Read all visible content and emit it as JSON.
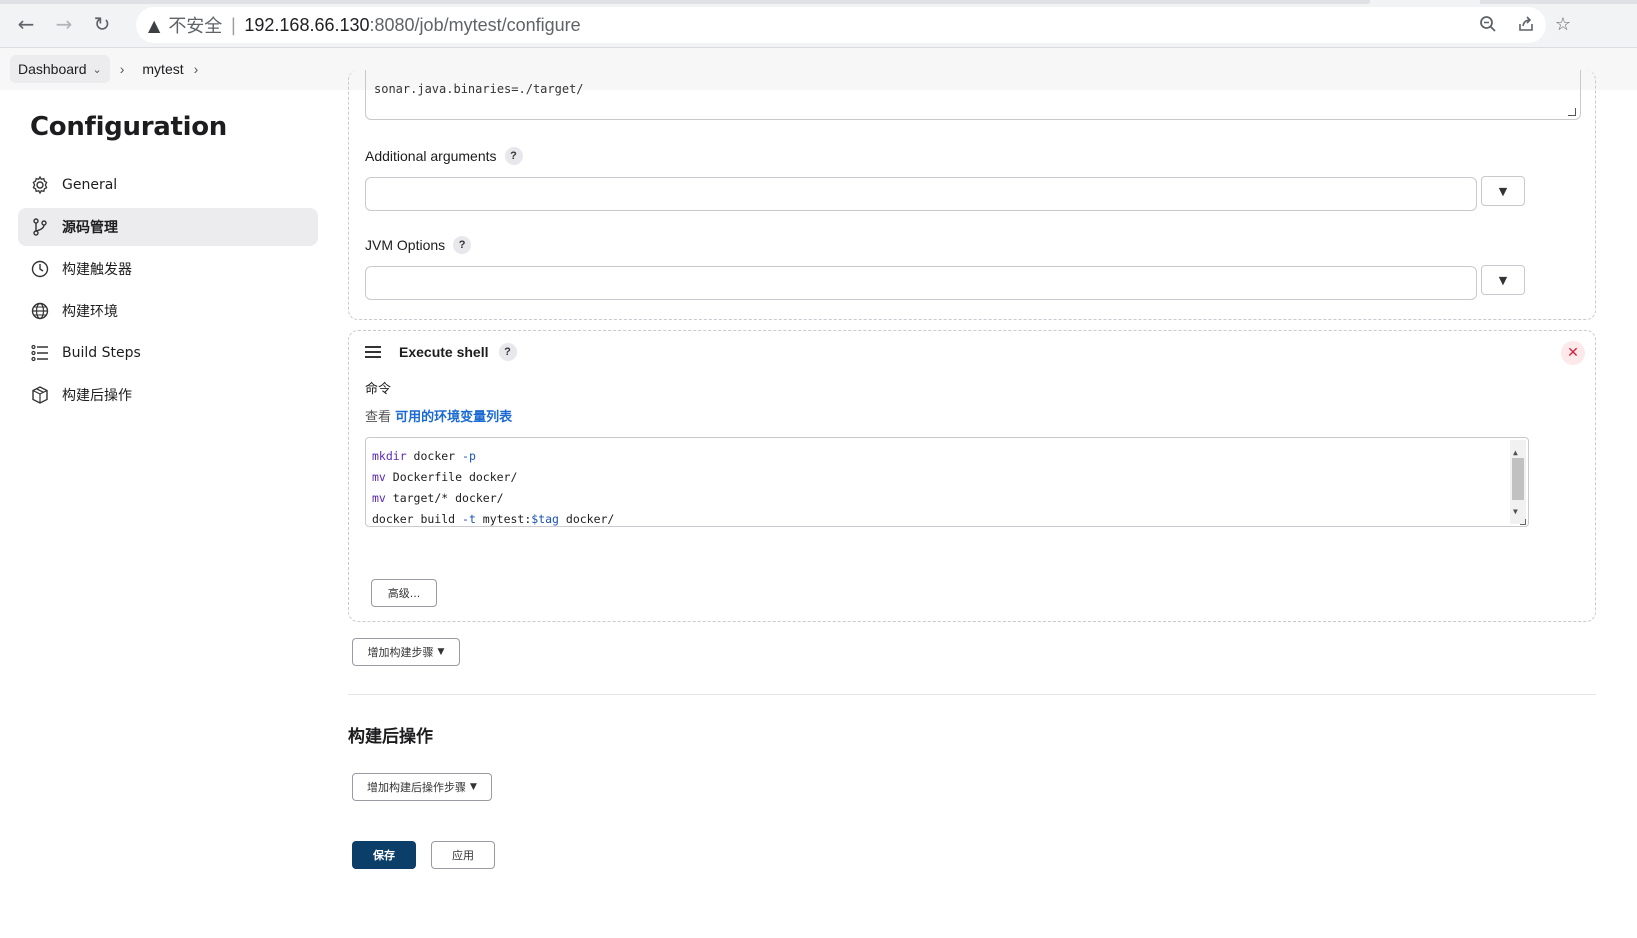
{
  "browser": {
    "insecure_label": "不安全",
    "separator": "|",
    "url_host": "192.168.66.130",
    "url_path": ":8080/job/mytest/configure"
  },
  "breadcrumb": {
    "items": [
      "Dashboard",
      "mytest"
    ]
  },
  "sidebar": {
    "title": "Configuration",
    "items": [
      {
        "label": "General",
        "icon": "gear-icon"
      },
      {
        "label": "源码管理",
        "icon": "branch-icon"
      },
      {
        "label": "构建触发器",
        "icon": "clock-icon"
      },
      {
        "label": "构建环境",
        "icon": "globe-icon"
      },
      {
        "label": "Build Steps",
        "icon": "list-icon"
      },
      {
        "label": "构建后操作",
        "icon": "package-icon"
      }
    ]
  },
  "main": {
    "sonar_textarea_tail": "sonar.java.binaries=./target/",
    "additional_args_label": "Additional arguments",
    "jvm_options_label": "JVM Options",
    "help_glyph": "?",
    "dropdown_glyph": "▼",
    "execute_shell": {
      "title": "Execute shell",
      "command_label": "命令",
      "env_prefix": "查看 ",
      "env_link": "可用的环境变量列表",
      "close_glyph": "✕",
      "code": [
        {
          "kw": "mkdir",
          "rest": " docker ",
          "flag": "-p"
        },
        {
          "kw": "mv",
          "rest": " Dockerfile docker/"
        },
        {
          "kw": "mv",
          "rest": " target/* docker/"
        },
        {
          "plain": "docker build ",
          "flag": "-t",
          "rest": " mytest:",
          "var": "$tag",
          "tail": " docker/"
        }
      ],
      "advanced_label": "高级..."
    },
    "add_build_step_label": "增加构建步骤",
    "post_build_title": "构建后操作",
    "add_post_build_label": "增加构建后操作步骤",
    "save_label": "保存",
    "apply_label": "应用"
  },
  "colors": {
    "primary": "#0b3e68",
    "link": "#1b6ad3",
    "danger": "#d21f3c"
  }
}
